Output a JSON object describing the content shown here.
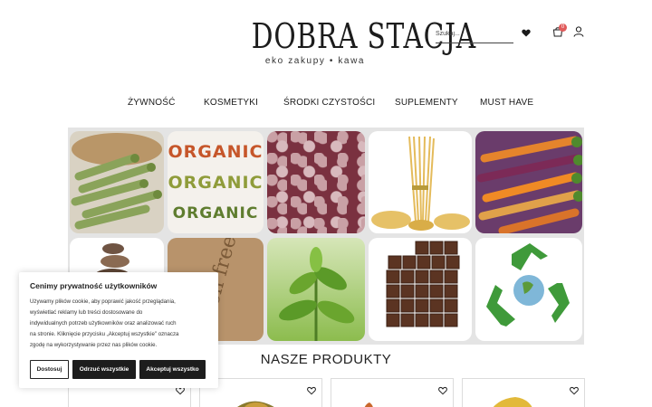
{
  "brand": {
    "title": "DOBRA STACJA",
    "tagline": "eko zakupy • kawa"
  },
  "header": {
    "search_placeholder": "Szukaj...",
    "cart_count": "0"
  },
  "nav": {
    "items": [
      {
        "label": "ŻYWNOŚĆ"
      },
      {
        "label": "KOSMETYKI"
      },
      {
        "label": "ŚRODKI CZYSTOŚCI"
      },
      {
        "label": "SUPLEMENTY"
      },
      {
        "label": "MUST HAVE"
      }
    ]
  },
  "hero": {
    "tiles": [
      {
        "name": "asparagus-image",
        "color": "#8aa35a"
      },
      {
        "name": "organic-letters-image",
        "color": "#f4f1ec"
      },
      {
        "name": "beans-image",
        "color": "#7a3140"
      },
      {
        "name": "pasta-image",
        "color": "#e6c167"
      },
      {
        "name": "carrots-image",
        "color": "#d9732a"
      },
      {
        "name": "stones-image",
        "color": "#8a6a52"
      },
      {
        "name": "gluten-free-image",
        "color": "#b8936b"
      },
      {
        "name": "tea-leaves-image",
        "color": "#6aa52e"
      },
      {
        "name": "brownies-image",
        "color": "#5b3422"
      },
      {
        "name": "recycle-image",
        "color": "#3f9a3a"
      }
    ],
    "organic_word": "ORGANIC",
    "gluten_free_text": "gluten free"
  },
  "products": {
    "title": "NASZE PRODUKTY"
  },
  "cookie": {
    "title": "Cenimy prywatność użytkowników",
    "lines": [
      "Używamy plików cookie, aby poprawić jakość przeglądania,",
      "wyświetlać reklamy lub treści dostosowane do",
      "indywidualnych potrzeb użytkowników oraz analizować ruch",
      "na stronie. Kliknięcie przycisku „Akceptuj wszystkie\" oznacza",
      "zgodę na wykorzystywanie przez nas plików cookie."
    ],
    "customize_label": "Dostosuj",
    "reject_label": "Odrzuć wszystkie",
    "accept_label": "Akceptuj wszystko"
  },
  "colors": {
    "accent": "#1d1d1d",
    "badge": "#e05a5a",
    "hero_bg": "#e4e4e4"
  }
}
